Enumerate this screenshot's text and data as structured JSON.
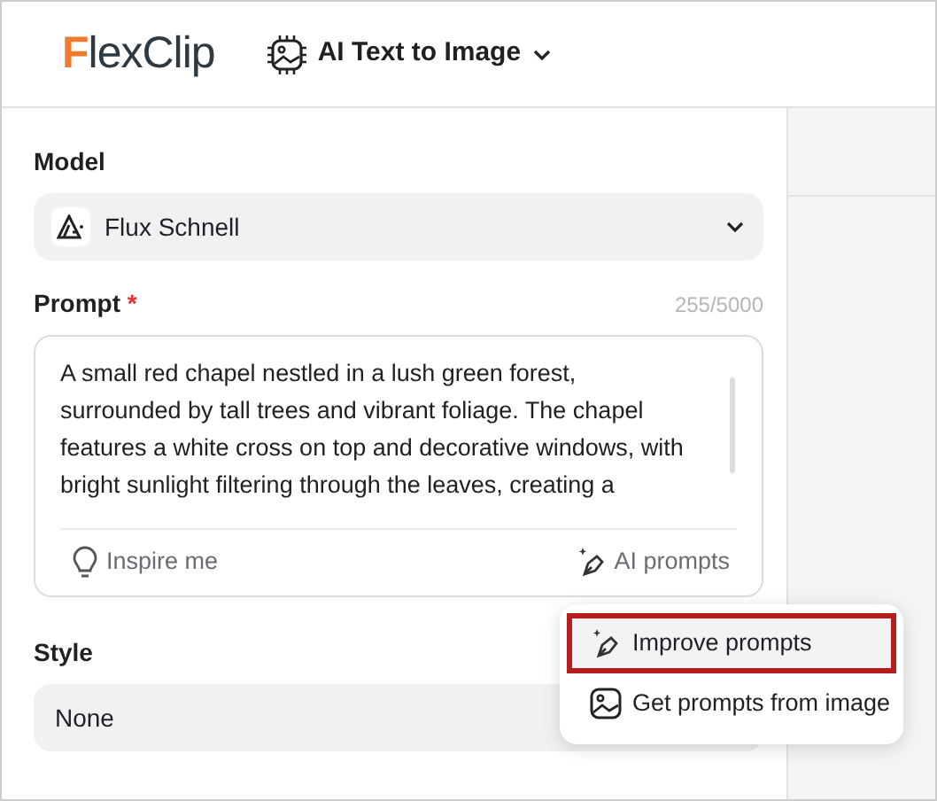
{
  "header": {
    "logo": "FlexClip",
    "tool": "AI Text to Image"
  },
  "model": {
    "label": "Model",
    "value": "Flux Schnell"
  },
  "prompt": {
    "label": "Prompt",
    "required_mark": "*",
    "counter": "255/5000",
    "value": "A small red chapel nestled in a lush green forest, surrounded by tall trees and vibrant foliage. The chapel features a white cross on top and decorative windows, with bright sunlight filtering through the leaves, creating a",
    "inspire": "Inspire me",
    "ai_prompts": "AI prompts"
  },
  "style": {
    "label": "Style",
    "value": "None"
  },
  "menu": [
    {
      "label": "Improve prompts",
      "kind": "improve",
      "selected": true
    },
    {
      "label": "Get prompts from image",
      "kind": "image",
      "selected": false
    }
  ]
}
